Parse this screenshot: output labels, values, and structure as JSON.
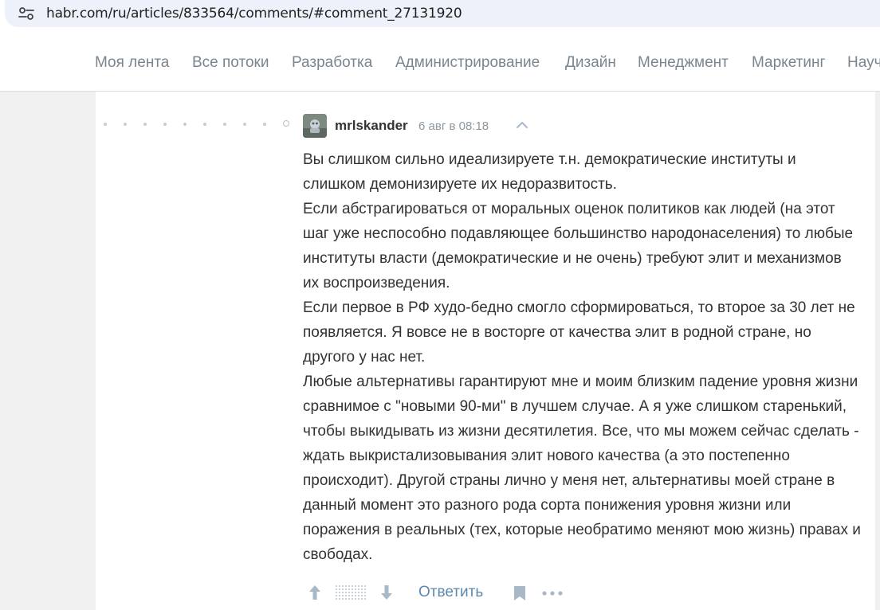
{
  "browser": {
    "url": "habr.com/ru/articles/833564/comments/#comment_27131920"
  },
  "nav": {
    "items": [
      "Моя лента",
      "Все потоки",
      "Разработка",
      "Администрирование",
      "Дизайн",
      "Менеджмент",
      "Маркетинг",
      "Научпоп"
    ]
  },
  "comment": {
    "author": "mrlskander",
    "time": "6 авг в 08:18",
    "paragraphs": [
      "Вы слишком сильно идеализируете т.н. демократические институты и слишком демонизируете их недоразвитость.",
      "Если абстрагироваться от моральных оценок политиков как людей (на этот шаг уже неспособно подавляющее большинство народонаселения) то любые институты власти (демократические и не очень) требуют элит и механизмов их воспроизведения.",
      "Если первое в РФ худо-бедно смогло сформироваться, то второе за 30 лет не появляется. Я вовсе не в восторге от качества элит в родной стране, но другого у нас нет.",
      "Любые альтернативы гарантируют мне и моим близким падение уровня жизни сравнимое с \"новыми 90-ми\" в лучшем случае. А я уже слишком старенький, чтобы выкидывать из жизни десятилетия. Все, что мы можем сейчас сделать - ждать выкристализовывания элит нового качества (а это постепенно происходит). Другой страны лично у меня нет, альтернативы моей стране в данный момент это разного рода сорта понижения уровня жизни или поражения в реальных (тех, которые необратимо меняют мою жизнь) правах и свободах."
    ],
    "reply_label": "Ответить"
  },
  "icons": {
    "site_info": "tune-icon",
    "collapse": "chevron-up-icon",
    "vote_up": "arrow-up-icon",
    "vote_down": "arrow-down-icon",
    "bookmark": "bookmark-icon",
    "more": "more-dots-icon"
  },
  "colors": {
    "nav_text": "#7b858f",
    "link": "#5e89ad",
    "body_text": "#333333",
    "meta_text": "#8c97a0",
    "icon": "#a9b8c6",
    "page_bg": "#f0f0f0",
    "address_bar": "#edf2fa"
  }
}
